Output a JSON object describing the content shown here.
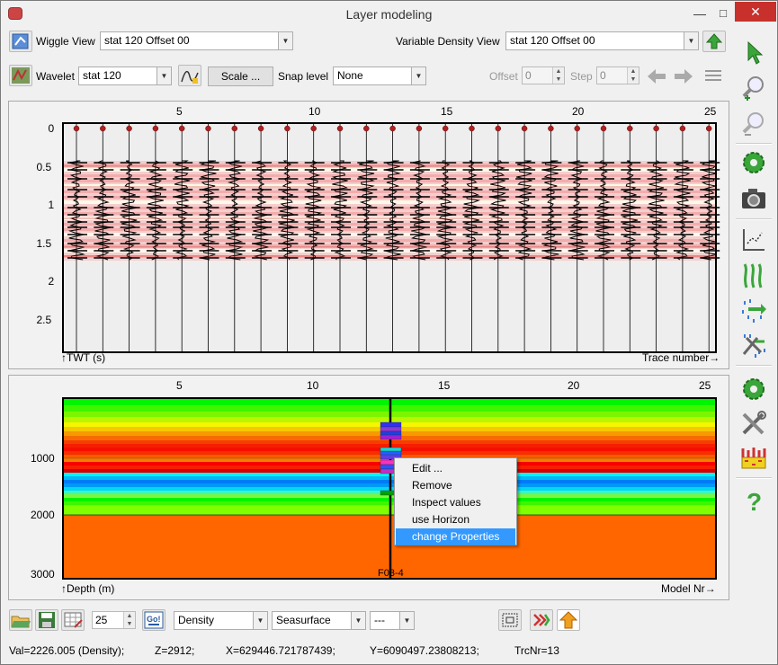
{
  "window": {
    "title": "Layer modeling"
  },
  "top_toolbar": {
    "wiggle_label": "Wiggle View",
    "wiggle_value": "stat 120 Offset 00",
    "vd_label": "Variable Density View",
    "vd_value": "stat 120 Offset 00",
    "wavelet_label": "Wavelet",
    "wavelet_value": "stat 120",
    "scale_label": "Scale ...",
    "snap_label": "Snap level",
    "snap_value": "None",
    "offset_label": "Offset",
    "offset_value": "0",
    "step_label": "Step",
    "step_value": "0"
  },
  "seismic_panel": {
    "x_ticks": [
      "5",
      "10",
      "15",
      "20",
      "25"
    ],
    "y_ticks": [
      "0",
      "0.5",
      "1",
      "1.5",
      "2",
      "2.5"
    ],
    "y_axis_label": "TWT (s)",
    "x_axis_label": "Trace number"
  },
  "model_panel": {
    "x_ticks": [
      "5",
      "10",
      "15",
      "20",
      "25"
    ],
    "y_ticks": [
      "1000",
      "2000",
      "3000"
    ],
    "y_axis_label": "Depth (m)",
    "x_axis_label": "Model Nr",
    "well_label": "F03-4"
  },
  "context_menu": {
    "items": [
      "Edit ...",
      "Remove",
      "Inspect values",
      "use Horizon",
      "change Properties"
    ],
    "selected_index": 4
  },
  "bottom_toolbar": {
    "nr_value": "25",
    "property_value": "Density",
    "surface_value": "Seasurface",
    "extra_value": "---"
  },
  "status": {
    "val": "Val=2226.005 (Density);",
    "z": "Z=2912;",
    "x": "X=629446.721787439;",
    "y": "Y=6090497.23808213;",
    "trc": "TrcNr=13"
  },
  "right_toolbar": {
    "icons": [
      "pointer-icon",
      "zoom-in-icon",
      "zoom-out-icon",
      "settings-icon",
      "camera-icon",
      "chart-icon",
      "wiggle-icon",
      "rain-arrow-icon",
      "rain-tools-icon",
      "settings2-icon",
      "tools-icon",
      "blocks-icon",
      "help-icon"
    ]
  }
}
